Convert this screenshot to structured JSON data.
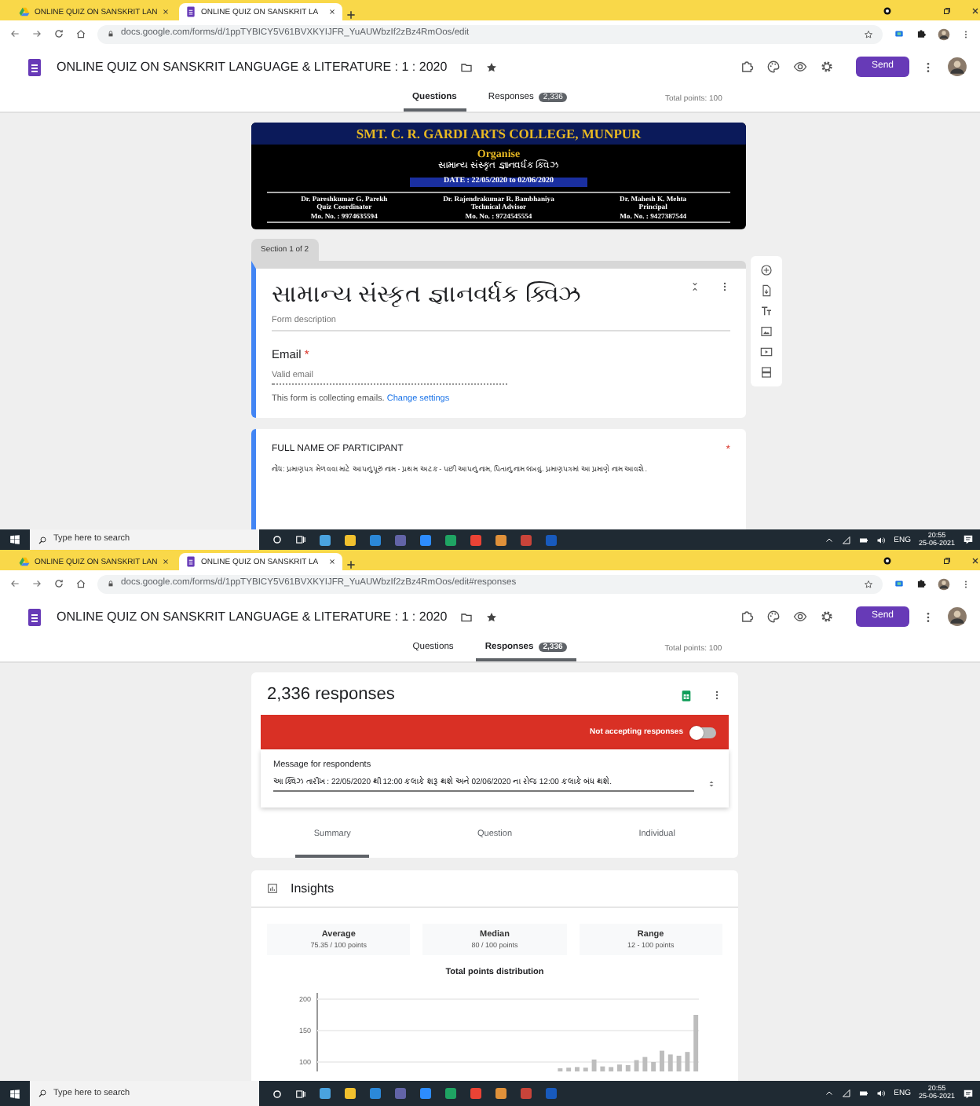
{
  "windows": [
    {
      "kind": "editor",
      "browser_tabs": [
        {
          "title": "ONLINE QUIZ ON SANSKRIT LAN",
          "kind": "drive",
          "selected": false
        },
        {
          "title": "ONLINE QUIZ ON SANSKRIT LA",
          "kind": "forms",
          "selected": true
        }
      ],
      "url": "docs.google.com/forms/d/1ppTYBICY5V61BVXKYIJFR_YuAUWbzIf2zBz4RmOos/edit",
      "form_title": "ONLINE QUIZ ON SANSKRIT LANGUAGE & LITERATURE : 1 : 2020",
      "send_label": "Send",
      "form_tabs": [
        {
          "label": "Questions",
          "selected": true
        },
        {
          "label": "Responses",
          "selected": false,
          "badge": "2,336"
        }
      ],
      "total_points": "Total points: 100",
      "editor": {
        "banner": {
          "college": "SMT. C. R. GARDI ARTS COLLEGE, MUNPUR",
          "heading": "Organise",
          "subtitle": "સામાન્ય સંસ્કૃત જ્ઞાનવર્ધક ક્વિઝ",
          "date": "DATE : 22/05/2020 to 02/06/2020",
          "people": [
            {
              "name": "Dr. Pareshkumar G. Parekh",
              "role": "Quiz Coordinator",
              "phone": "Mo. No. : 9974635594"
            },
            {
              "name": "Dr. Rajendrakumar R. Bambhaniya",
              "role": "Technical Advisor",
              "phone": "Mo. No. : 9724545554"
            },
            {
              "name": "Dr. Mahesh K. Mehta",
              "role": "Principal",
              "phone": "Mo. No. : 9427387544"
            }
          ]
        },
        "section_label": "Section 1 of 2",
        "title": "સામાન્ય સંસ્કૃત જ્ઞાનવર્ધક ક્વિઝ",
        "description_placeholder": "Form description",
        "email": {
          "label": "Email",
          "required_mark": "*",
          "placeholder": "Valid email"
        },
        "collecting_note": "This form is collecting emails.",
        "collecting_link": "Change settings",
        "question": {
          "title": "FULL NAME OF PARTICIPANT",
          "required_mark": "*",
          "description": "નોંધ: પ્રમાણપત્ર મેળવવા માટે આપનું પૂરું નામ - પ્રથમ અટક - પછી આપનું નામ, પિતાનું નામ લખવું. પ્રમાણપત્રમાં આ પ્રમાણે નામ આવશે."
        }
      },
      "taskbar": {
        "search_placeholder": "Type here to search",
        "language": "ENG",
        "time": "20:55",
        "date": "25-06-2021"
      }
    },
    {
      "kind": "responses",
      "browser_tabs": [
        {
          "title": "ONLINE QUIZ ON SANSKRIT LAN",
          "kind": "drive",
          "selected": false
        },
        {
          "title": "ONLINE QUIZ ON SANSKRIT LA",
          "kind": "forms",
          "selected": true
        }
      ],
      "url": "docs.google.com/forms/d/1ppTYBICY5V61BVXKYIJFR_YuAUWbzIf2zBz4RmOos/edit#responses",
      "form_title": "ONLINE QUIZ ON SANSKRIT LANGUAGE & LITERATURE : 1 : 2020",
      "send_label": "Send",
      "form_tabs": [
        {
          "label": "Questions",
          "selected": false
        },
        {
          "label": "Responses",
          "selected": true,
          "badge": "2,336"
        }
      ],
      "total_points": "Total points: 100",
      "responses": {
        "count": "2,336 responses",
        "accepting": false,
        "status_label": "Not accepting responses",
        "message_label": "Message for respondents",
        "message": "આ ક્વિઝ તારીખ : 22/05/2020 થી 12:00 કલાકે શરૂ થશે અને 02/06/2020 ના રોજ 12:00 કલાકે બંધ થશે.",
        "subtabs": [
          {
            "label": "Summary",
            "selected": true
          },
          {
            "label": "Question",
            "selected": false
          },
          {
            "label": "Individual",
            "selected": false
          }
        ],
        "insights_title": "Insights",
        "stats": [
          {
            "label": "Average",
            "value": "75.35 / 100 points"
          },
          {
            "label": "Median",
            "value": "80 / 100 points"
          },
          {
            "label": "Range",
            "value": "12 - 100 points"
          }
        ],
        "chart_data": {
          "type": "bar",
          "title": "Total points distribution",
          "ylim": [
            85,
            205
          ],
          "yticks": [
            100,
            150,
            200
          ],
          "values": [
            null,
            null,
            null,
            null,
            null,
            null,
            null,
            null,
            null,
            null,
            null,
            null,
            null,
            null,
            null,
            null,
            null,
            null,
            null,
            null,
            null,
            null,
            null,
            null,
            null,
            null,
            null,
            null,
            90,
            91,
            92,
            91,
            104,
            93,
            92,
            96,
            95,
            103,
            108,
            100,
            118,
            112,
            110,
            116,
            175
          ]
        }
      },
      "taskbar": {
        "search_placeholder": "Type here to search",
        "language": "ENG",
        "time": "20:55",
        "date": "25-06-2021"
      }
    }
  ]
}
